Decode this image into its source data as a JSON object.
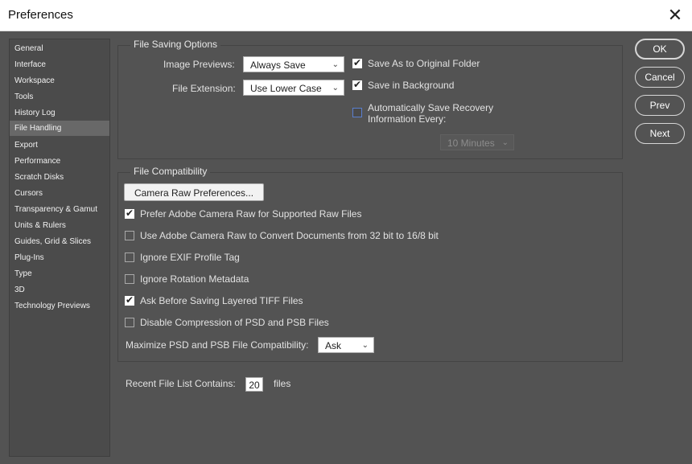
{
  "window": {
    "title": "Preferences",
    "close_icon": "close-icon"
  },
  "sidebar": {
    "items": [
      {
        "label": "General"
      },
      {
        "label": "Interface"
      },
      {
        "label": "Workspace"
      },
      {
        "label": "Tools"
      },
      {
        "label": "History Log"
      },
      {
        "label": "File Handling",
        "selected": true
      },
      {
        "label": "Export"
      },
      {
        "label": "Performance"
      },
      {
        "label": "Scratch Disks"
      },
      {
        "label": "Cursors"
      },
      {
        "label": "Transparency & Gamut"
      },
      {
        "label": "Units & Rulers"
      },
      {
        "label": "Guides, Grid & Slices"
      },
      {
        "label": "Plug-Ins"
      },
      {
        "label": "Type"
      },
      {
        "label": "3D"
      },
      {
        "label": "Technology Previews"
      }
    ]
  },
  "file_saving": {
    "title": "File Saving Options",
    "image_previews_label": "Image Previews:",
    "image_previews_value": "Always Save",
    "file_extension_label": "File Extension:",
    "file_extension_value": "Use Lower Case",
    "save_as_original": {
      "label": "Save As to Original Folder",
      "checked": true
    },
    "save_in_background": {
      "label": "Save in Background",
      "checked": true
    },
    "auto_recovery": {
      "label_line1": "Automatically Save Recovery",
      "label_line2": "Information Every:",
      "checked": false
    },
    "interval_value": "10 Minutes"
  },
  "file_compat": {
    "title": "File Compatibility",
    "camera_raw_button": "Camera Raw Preferences...",
    "options": [
      {
        "label": "Prefer Adobe Camera Raw for Supported Raw Files",
        "checked": true
      },
      {
        "label": "Use Adobe Camera Raw to Convert Documents from 32 bit to 16/8 bit",
        "checked": false
      },
      {
        "label": "Ignore EXIF Profile Tag",
        "checked": false
      },
      {
        "label": "Ignore Rotation Metadata",
        "checked": false
      },
      {
        "label": "Ask Before Saving Layered TIFF Files",
        "checked": true
      },
      {
        "label": "Disable Compression of PSD and PSB Files",
        "checked": false
      }
    ],
    "maximize_label": "Maximize PSD and PSB File Compatibility:",
    "maximize_value": "Ask"
  },
  "recent_files": {
    "label": "Recent File List Contains:",
    "value": "20",
    "suffix": "files"
  },
  "buttons": {
    "ok": "OK",
    "cancel": "Cancel",
    "prev": "Prev",
    "next": "Next"
  },
  "checkmark_glyph": "✔",
  "colors": {
    "dialog_bg": "#535353",
    "sidebar_bg": "#4b4b4b",
    "selected_bg": "#686868",
    "focus_blue": "#5a7fcf"
  }
}
